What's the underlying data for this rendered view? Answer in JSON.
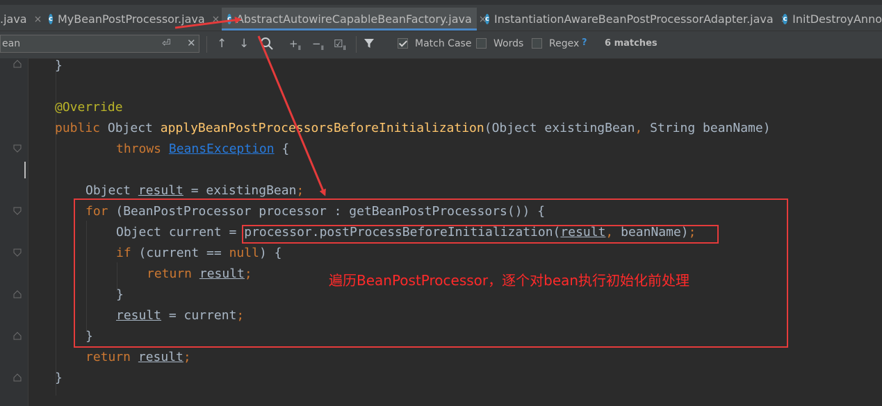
{
  "tabs": [
    {
      "label": ".java",
      "close": "×"
    },
    {
      "label": "MyBeanPostProcessor.java",
      "close": "×"
    },
    {
      "label": "AbstractAutowireCapableBeanFactory.java",
      "close": "×"
    },
    {
      "label": "InstantiationAwareBeanPostProcessorAdapter.java",
      "close": "×"
    },
    {
      "label": "InitDestroyAnno"
    }
  ],
  "find": {
    "query": "ean",
    "match_case": {
      "label": "Match Case",
      "checked": true
    },
    "words": {
      "label": "Words",
      "checked": false
    },
    "regex": {
      "label": "Regex",
      "checked": false
    },
    "help": "?",
    "matches": "6 matches"
  },
  "code": {
    "l0": {
      "brace": "}"
    },
    "l2": {
      "annotation": "@Override"
    },
    "l3": {
      "kw": "public",
      "t1": " Object ",
      "method": "applyBeanPostProcessorsBeforeInitialization",
      "t2": "(Object existingBean",
      "comma": ",",
      "t3": " String beanName)"
    },
    "l4": {
      "kw": "throws",
      "sp": " ",
      "exc": "BeansException",
      "t": " {"
    },
    "l6": {
      "t1": "Object ",
      "var": "result",
      "t2": " = existingBean",
      "semi": ";"
    },
    "l7": {
      "kw": "for",
      "t": " (BeanPostProcessor processor : getBeanPostProcessors()) {"
    },
    "l8": {
      "t1": "Object current = processor.postProcessBeforeInitialization(",
      "var": "result",
      "comma": ",",
      "t2": " beanName)",
      "semi": ";"
    },
    "l9": {
      "kw": "if",
      "t1": " (current == ",
      "kw2": "null",
      "t2": ") {"
    },
    "l10": {
      "kw": "return",
      "sp": " ",
      "var": "result",
      "semi": ";"
    },
    "l11": {
      "brace": "}"
    },
    "l12": {
      "var": "result",
      "t": " = current",
      "semi": ";"
    },
    "l13": {
      "brace": "}"
    },
    "l14": {
      "kw": "return",
      "sp": " ",
      "var": "result",
      "semi": ";"
    },
    "l15": {
      "brace": "}"
    }
  },
  "annotation_note": "遍历BeanPostProcessor，逐个对bean执行初始化前处理",
  "colors": {
    "annotation_red": "#e53b3b",
    "keyword": "#cc7832",
    "method": "#ffc66d",
    "text": "#a9b7c6"
  },
  "icons": [
    "class-c-icon",
    "close-icon",
    "enter-icon",
    "clear-icon",
    "arrow-up-icon",
    "arrow-down-icon",
    "search-icon",
    "add-selection-icon",
    "remove-selection-icon",
    "select-all-icon",
    "filter-icon",
    "fold-icon"
  ]
}
